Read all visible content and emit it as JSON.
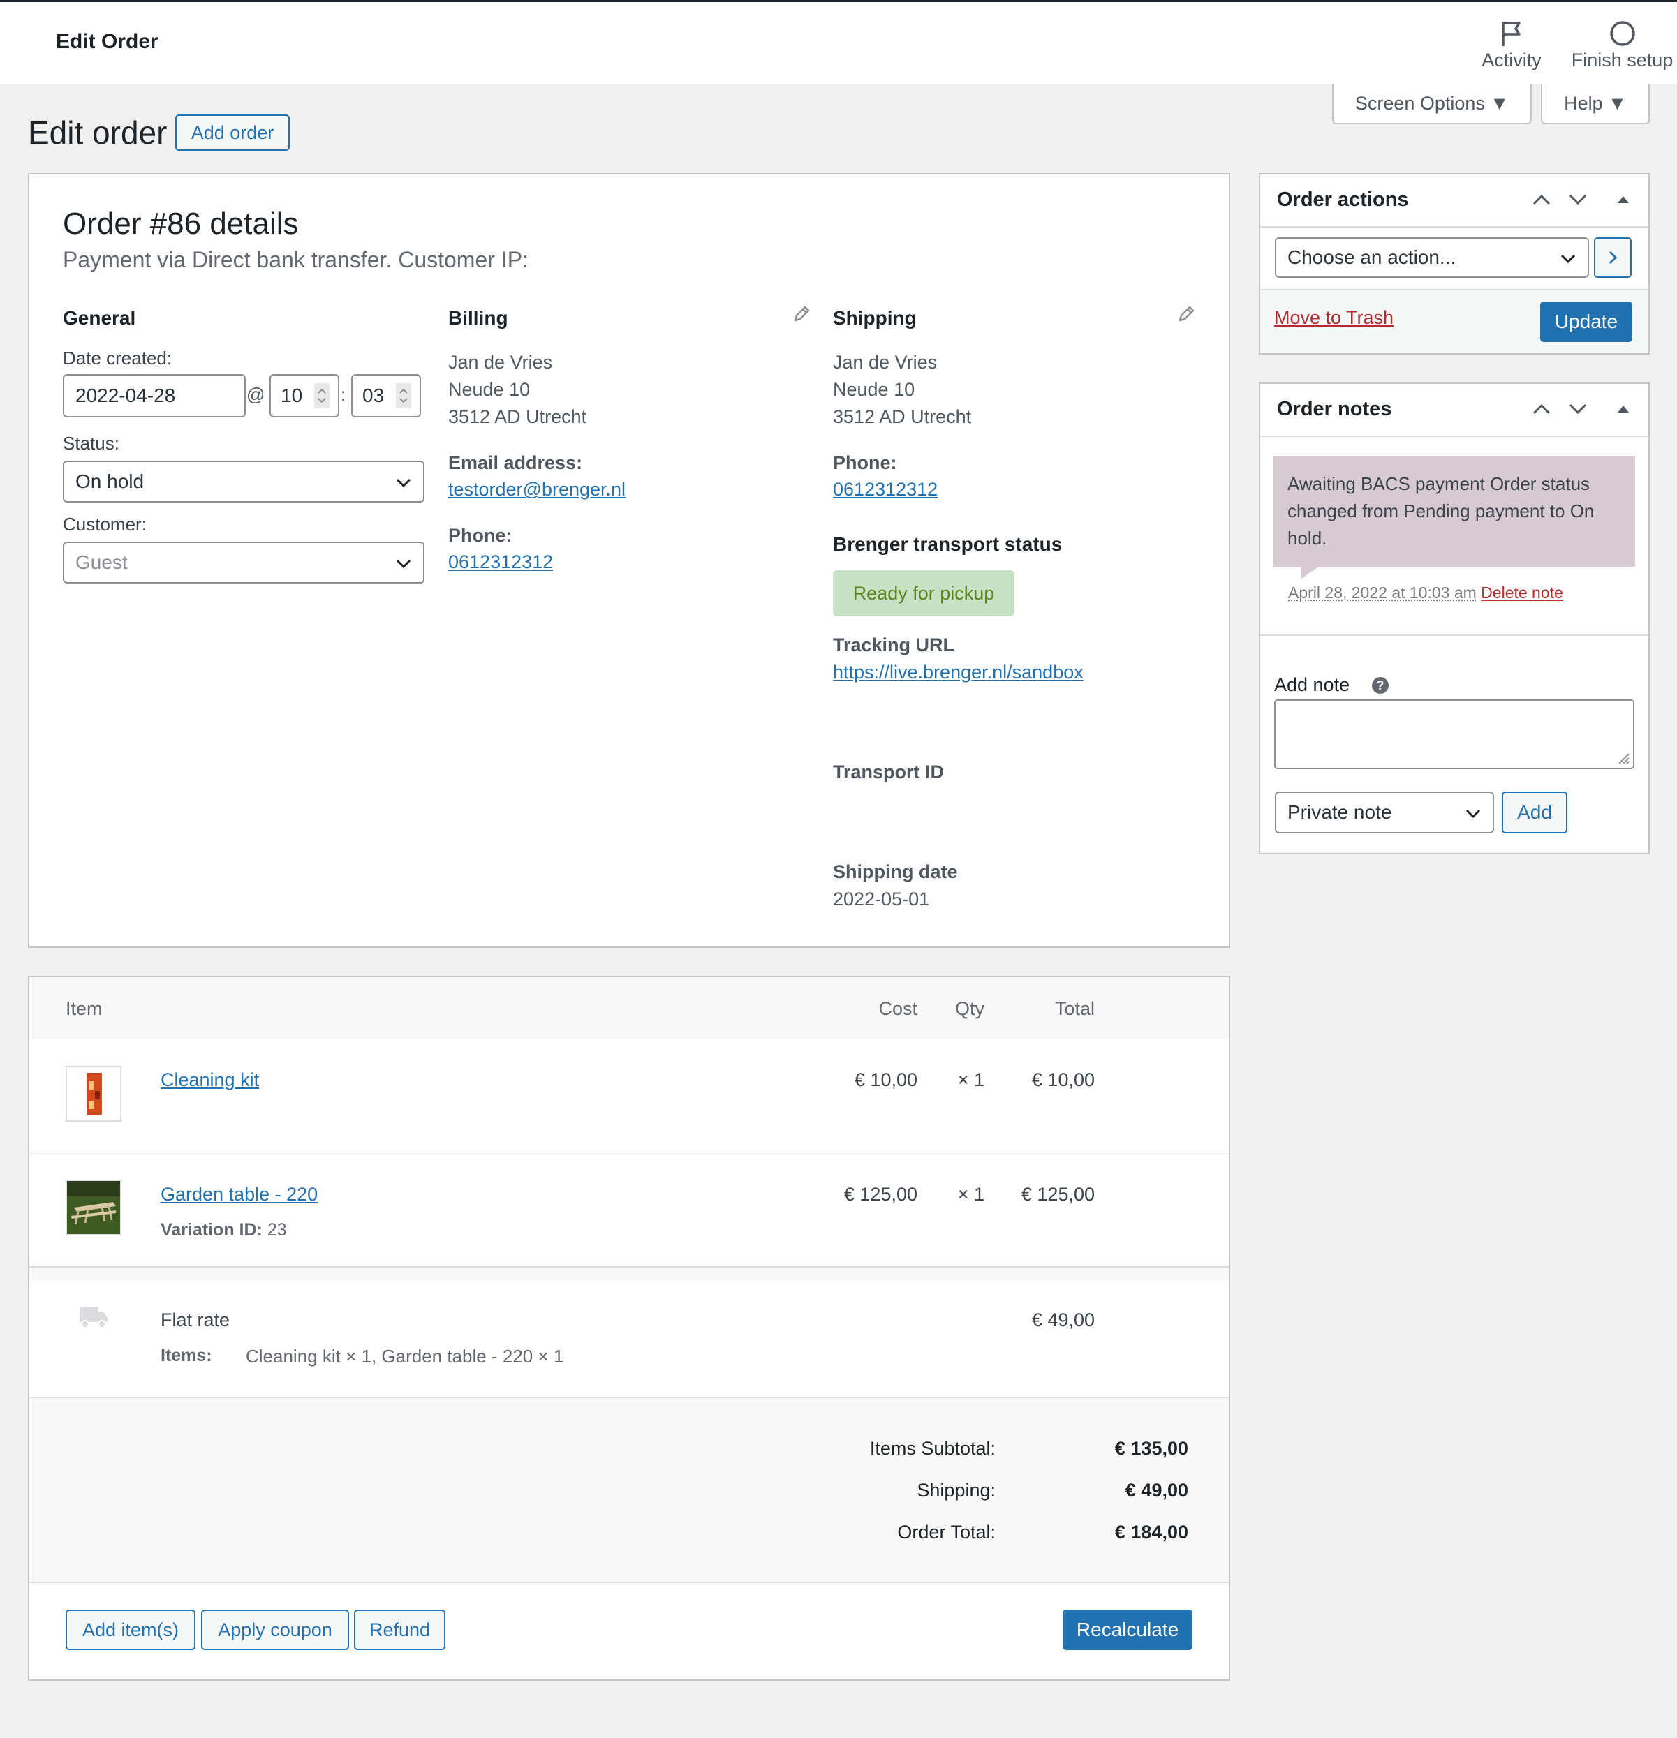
{
  "topbar": {
    "title": "Edit Order",
    "activity_label": "Activity",
    "finish_setup_label": "Finish setup"
  },
  "screen_options": {
    "screen_options_label": "Screen Options ▼",
    "help_label": "Help ▼"
  },
  "page": {
    "heading": "Edit order",
    "add_order_label": "Add order"
  },
  "order": {
    "title": "Order #86 details",
    "subtitle": "Payment via Direct bank transfer. Customer IP:",
    "general": {
      "heading": "General",
      "date_label": "Date created:",
      "date_value": "2022-04-28",
      "at": "@",
      "hour": "10",
      "colon": ":",
      "minute": "03",
      "status_label": "Status:",
      "status_value": "On hold",
      "customer_label": "Customer:",
      "customer_value": "Guest"
    },
    "billing": {
      "heading": "Billing",
      "name": "Jan de Vries",
      "street": "Neude 10",
      "city": "3512 AD Utrecht",
      "email_label": "Email address:",
      "email": "testorder@brenger.nl",
      "phone_label": "Phone:",
      "phone": "0612312312"
    },
    "shipping": {
      "heading": "Shipping",
      "name": "Jan de Vries",
      "street": "Neude 10",
      "city": "3512 AD Utrecht",
      "phone_label": "Phone:",
      "phone": "0612312312",
      "transport_heading": "Brenger transport status",
      "transport_status": "Ready for pickup",
      "tracking_label": "Tracking URL",
      "tracking_url": "https://live.brenger.nl/sandbox",
      "transport_id_label": "Transport ID",
      "shipping_date_label": "Shipping date",
      "shipping_date": "2022-05-01"
    }
  },
  "items": {
    "headers": {
      "item": "Item",
      "cost": "Cost",
      "qty": "Qty",
      "total": "Total"
    },
    "rows": [
      {
        "name": "Cleaning kit",
        "cost": "€ 10,00",
        "qty": "× 1",
        "total": "€ 10,00",
        "meta_label": "",
        "meta_value": ""
      },
      {
        "name": "Garden table - 220",
        "cost": "€ 125,00",
        "qty": "× 1",
        "total": "€ 125,00",
        "meta_label": "Variation ID:",
        "meta_value": "23"
      }
    ],
    "shipping_line": {
      "name": "Flat rate",
      "total": "€ 49,00",
      "items_label": "Items:",
      "items_value": "Cleaning kit × 1, Garden table - 220 × 1"
    },
    "totals": {
      "subtotal_label": "Items Subtotal:",
      "subtotal": "€ 135,00",
      "shipping_label": "Shipping:",
      "shipping": "€ 49,00",
      "total_label": "Order Total:",
      "total": "€ 184,00"
    },
    "buttons": {
      "add_items": "Add item(s)",
      "apply_coupon": "Apply coupon",
      "refund": "Refund",
      "recalculate": "Recalculate"
    }
  },
  "order_actions": {
    "heading": "Order actions",
    "select_value": "Choose an action...",
    "trash_label": "Move to Trash",
    "update_label": "Update"
  },
  "order_notes": {
    "heading": "Order notes",
    "note_text": "Awaiting BACS payment Order status changed from Pending payment to On hold.",
    "note_meta": "April 28, 2022 at 10:03 am",
    "delete_label": "Delete note",
    "add_note_label": "Add note",
    "help_glyph": "?",
    "note_type": "Private note",
    "add_label": "Add"
  },
  "colors": {
    "accent": "#2271b1",
    "danger": "#b32d2e",
    "note_bg": "#d7cad2",
    "ready_bg": "#c6e1c6",
    "ready_fg": "#5b841b"
  }
}
